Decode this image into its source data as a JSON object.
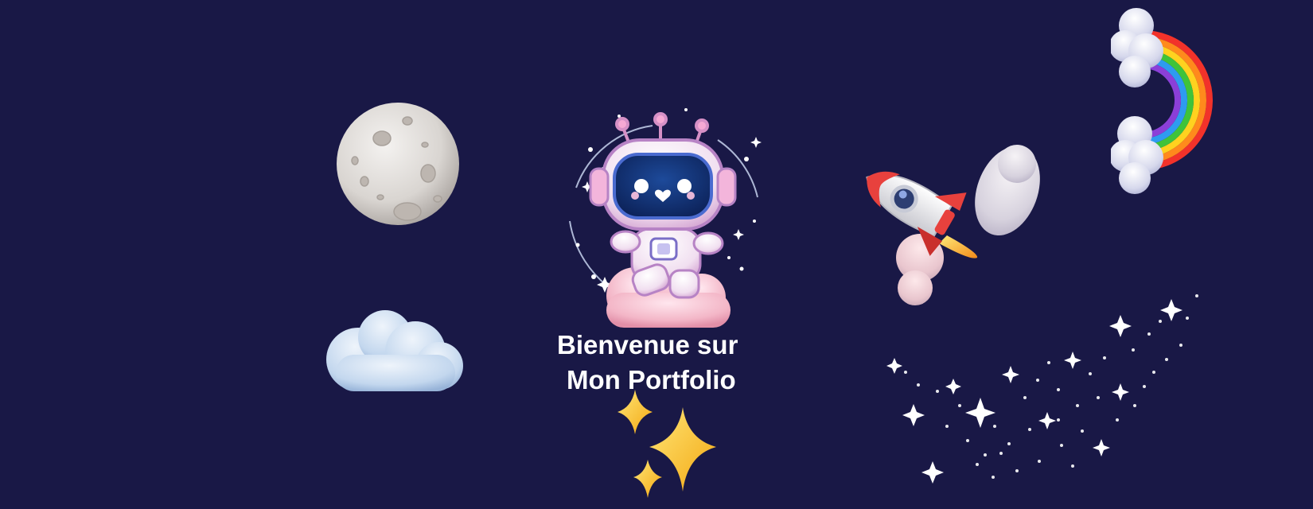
{
  "hero": {
    "title_line1": "Bienvenue sur",
    "title_line2": "Mon Portfolio"
  },
  "decorations": {
    "icons": [
      "moon-icon",
      "cloud-icon",
      "astronaut-icon",
      "sparkles-icon",
      "rocket-icon",
      "rainbow-icon",
      "star-trail-icon"
    ]
  },
  "colors": {
    "background": "#191846",
    "text": "#ffffff",
    "sparkle": "#f7c432"
  }
}
